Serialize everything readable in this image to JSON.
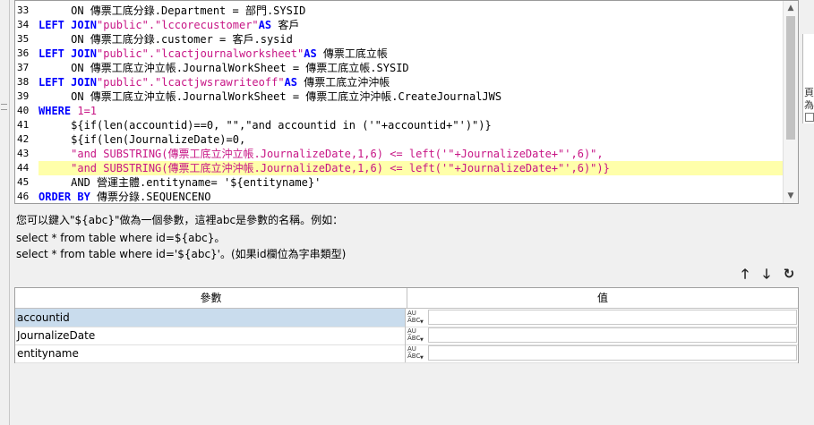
{
  "editor": {
    "lines": [
      {
        "n": "33",
        "segs": [
          {
            "t": "     ON 傳票工底分錄.Department = 部門.SYSID",
            "c": "op"
          }
        ]
      },
      {
        "n": "34",
        "segs": [
          {
            "t": "LEFT JOIN",
            "c": "kw"
          },
          {
            "t": "\"public\".\"lccorecustomer\"",
            "c": "str"
          },
          {
            "t": "AS",
            "c": "kw"
          },
          {
            "t": " 客戶",
            "c": "op"
          }
        ]
      },
      {
        "n": "35",
        "segs": [
          {
            "t": "     ON 傳票工底分錄.customer = 客戶.sysid",
            "c": "op"
          }
        ]
      },
      {
        "n": "36",
        "segs": [
          {
            "t": "LEFT JOIN",
            "c": "kw"
          },
          {
            "t": "\"public\".\"lcactjournalworksheet\"",
            "c": "str"
          },
          {
            "t": "AS",
            "c": "kw"
          },
          {
            "t": " 傳票工底立帳",
            "c": "op"
          }
        ]
      },
      {
        "n": "37",
        "segs": [
          {
            "t": "     ON 傳票工底立沖立帳.JournalWorkSheet = 傳票工底立帳.SYSID",
            "c": "op"
          }
        ]
      },
      {
        "n": "38",
        "segs": [
          {
            "t": "LEFT JOIN",
            "c": "kw"
          },
          {
            "t": "\"public\".\"lcactjwsrawriteoff\"",
            "c": "str"
          },
          {
            "t": "AS",
            "c": "kw"
          },
          {
            "t": " 傳票工底立沖沖帳",
            "c": "op"
          }
        ]
      },
      {
        "n": "39",
        "segs": [
          {
            "t": "     ON 傳票工底立沖立帳.JournalWorkSheet = 傳票工底立沖沖帳.CreateJournalJWS",
            "c": "op"
          }
        ]
      },
      {
        "n": "40",
        "segs": [
          {
            "t": "WHERE",
            "c": "kw"
          },
          {
            "t": " 1=1",
            "c": "str"
          }
        ]
      },
      {
        "n": "41",
        "segs": [
          {
            "t": "     ${if(len(accountid)==0, \"\",\"and accountid in ('\"+accountid+\"')\")}",
            "c": "op"
          }
        ]
      },
      {
        "n": "42",
        "segs": [
          {
            "t": "     ${if(len(JournalizeDate)=0,",
            "c": "op"
          }
        ]
      },
      {
        "n": "43",
        "segs": [
          {
            "t": "     \"and SUBSTRING(傳票工底立沖立帳.JournalizeDate,1,6) <= left('\"+JournalizeDate+\"',6)\",",
            "c": "str"
          }
        ]
      },
      {
        "n": "44",
        "segs": [
          {
            "t": "     \"and SUBSTRING(傳票工底立沖沖帳.JournalizeDate,1,6) <= left('\"+JournalizeDate+\"',6)\")}",
            "c": "str"
          }
        ],
        "hl": true
      },
      {
        "n": "45",
        "segs": [
          {
            "t": "     AND 營運主體.entityname= '${entityname}'",
            "c": "op"
          }
        ]
      },
      {
        "n": "46",
        "segs": [
          {
            "t": "ORDER BY",
            "c": "kw"
          },
          {
            "t": " 傳票分錄.SEQUENCENO",
            "c": "op"
          }
        ]
      }
    ]
  },
  "help": {
    "line1": "您可以鍵入\"${abc}\"做為一個參數，這裡abc是參數的名稱。例如：",
    "line2": "select * from table where id=${abc}。",
    "line3": "select * from table where id='${abc}'。(如果id欄位為字串類型)"
  },
  "toolbar": {
    "up": "🡑",
    "down": "🡓",
    "refresh": "↻"
  },
  "grid": {
    "col_param": "參數",
    "col_value": "值",
    "type_top": "A̲U",
    "type_bottom": "ABC",
    "rows": [
      {
        "name": "accountid",
        "value": ""
      },
      {
        "name": "JournalizeDate",
        "value": ""
      },
      {
        "name": "entityname",
        "value": ""
      }
    ]
  },
  "side": {
    "right_glyph1": "頁",
    "right_glyph2": "為"
  }
}
